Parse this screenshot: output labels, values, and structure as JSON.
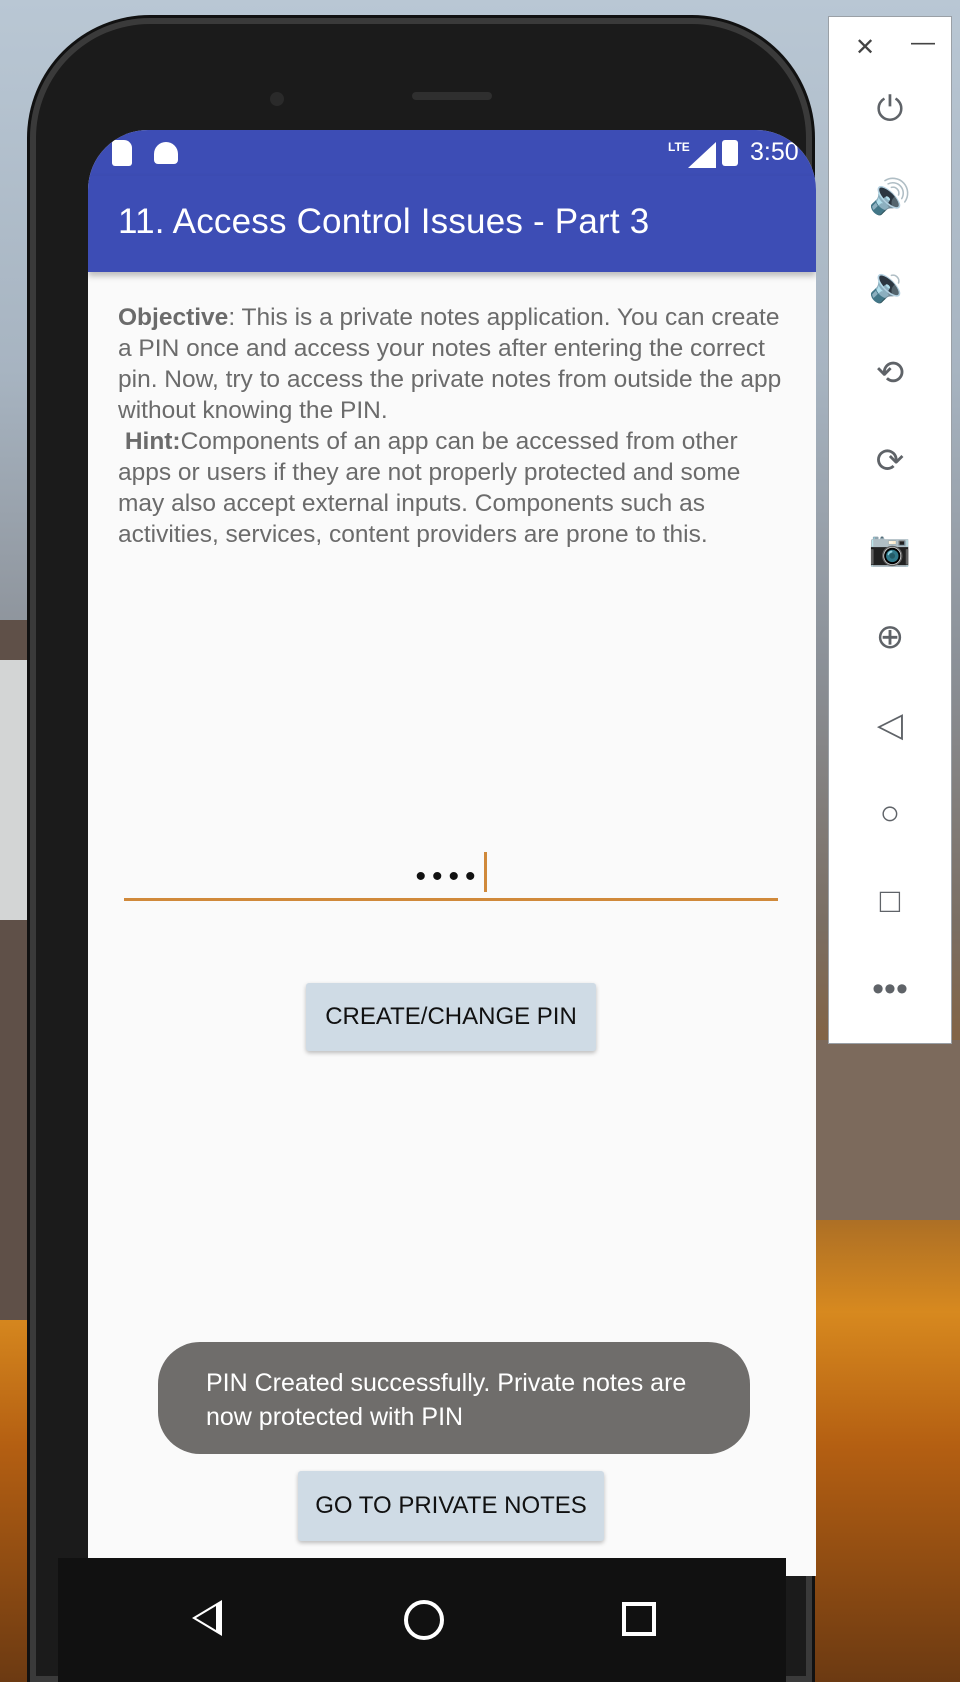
{
  "statusbar": {
    "time": "3:50",
    "network": "LTE"
  },
  "appbar": {
    "title": "11. Access Control Issues - Part 3"
  },
  "content": {
    "objective_label": "Objective",
    "objective_text": ": This is a private notes application. You can create a PIN once and access your notes after entering the correct pin. Now, try to access the private notes from outside the app without knowing the PIN.",
    "hint_label": "Hint:",
    "hint_text": "Components of an app can be accessed from other apps or users if they are not properly protected and some may also accept external inputs. Components such as activities, services, content providers are prone to this."
  },
  "pin_input": {
    "masked_value": "••••"
  },
  "buttons": {
    "create_pin": "CREATE/CHANGE PIN",
    "go_notes": "GO TO PRIVATE NOTES"
  },
  "toast": {
    "message": "PIN Created successfully. Private notes are now protected with PIN"
  },
  "emulator_panel": {
    "close": "✕",
    "minimize": "—",
    "icons": [
      "power-icon",
      "volume-up-icon",
      "volume-down-icon",
      "rotate-left-icon",
      "rotate-right-icon",
      "camera-icon",
      "zoom-icon",
      "back-icon",
      "home-icon",
      "overview-icon",
      "more-icon"
    ]
  },
  "colors": {
    "appbar": "#3d4db5",
    "accent": "#d0893a",
    "button": "#cfdbe5",
    "toast": "#6f6d6b"
  }
}
